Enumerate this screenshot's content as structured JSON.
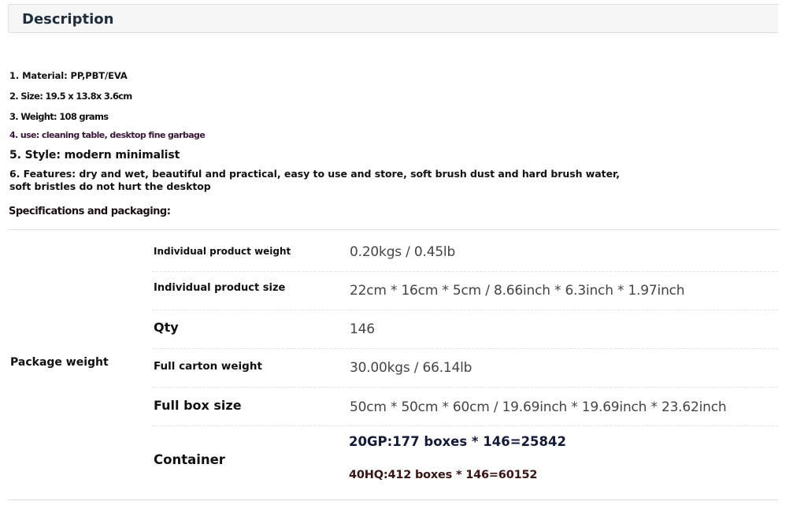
{
  "header": {
    "title": "Description"
  },
  "features": [
    "1. Material: PP,PBT/EVA",
    "2. Size: 19.5 x 13.8x 3.6cm",
    "3. Weight: 108 grams",
    "4. use: cleaning table, desktop fine garbage",
    "5. Style: modern minimalist",
    "6. Features: dry and wet, beautiful and practical, easy to use and store, soft brush dust and hard brush water, soft bristles do not hurt the desktop"
  ],
  "specs": {
    "title": "Specifications and packaging:",
    "group_label": "Package weight",
    "rows": [
      {
        "label": "Individual product weight",
        "value": "0.20kgs / 0.45lb"
      },
      {
        "label": "Individual product size",
        "value": "22cm * 16cm * 5cm / 8.66inch * 6.3inch * 1.97inch"
      },
      {
        "label": "Qty",
        "value": "146"
      },
      {
        "label": "Full carton weight",
        "value": "30.00kgs / 66.14lb"
      },
      {
        "label": "Full box size",
        "value": "50cm * 50cm * 60cm / 19.69inch * 19.69inch * 23.62inch"
      }
    ],
    "container": {
      "label": "Container",
      "values": [
        "20GP:177 boxes * 146=25842",
        "40HQ:412 boxes * 146=60152"
      ],
      "colors": [
        "#131a3a",
        "#3a1414"
      ]
    }
  }
}
